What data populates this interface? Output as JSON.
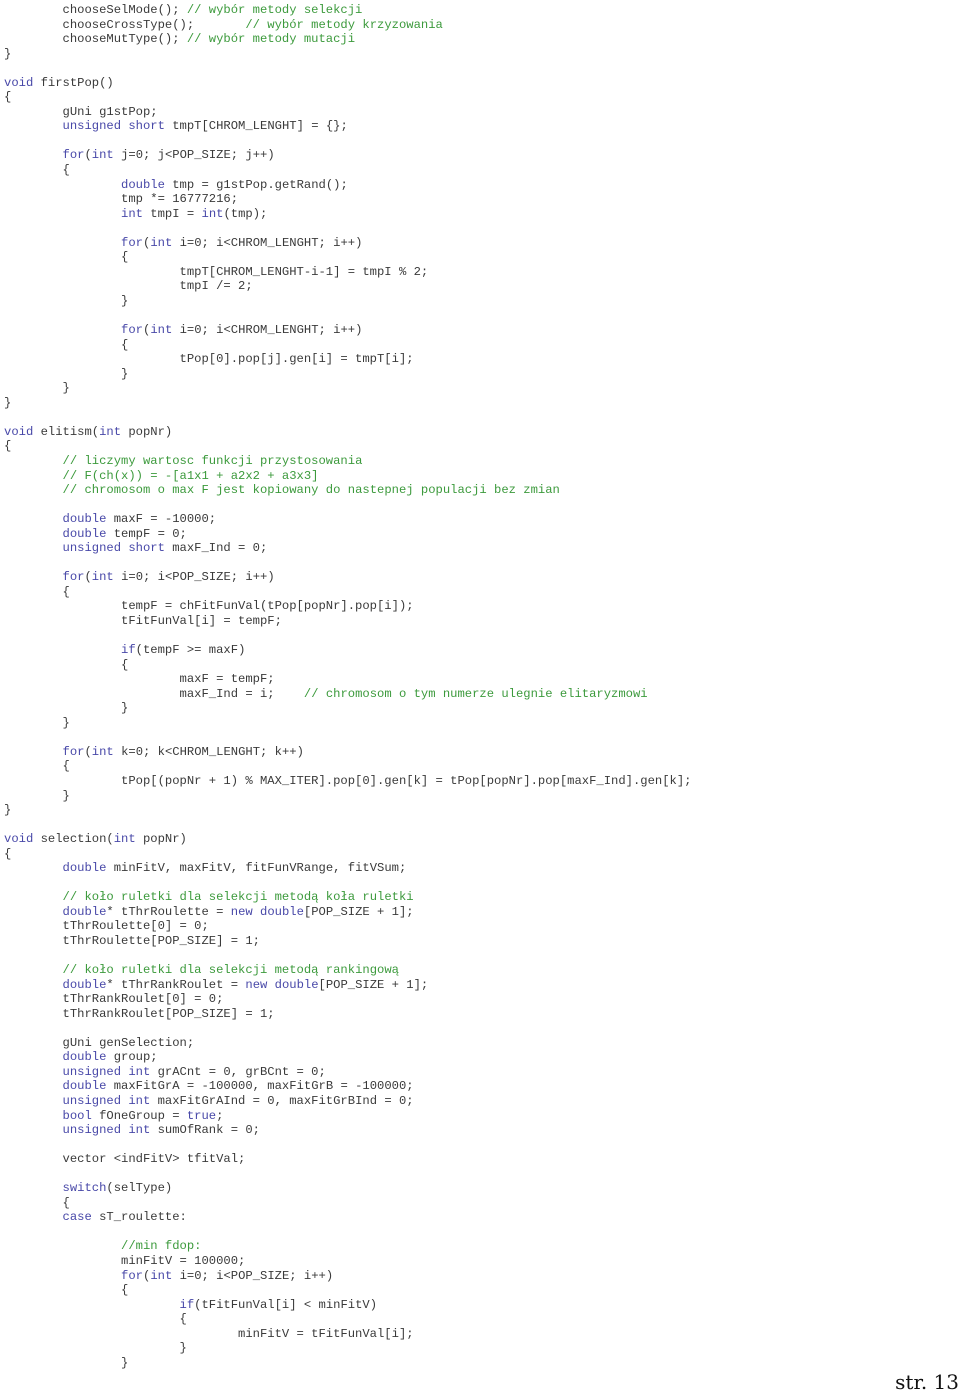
{
  "document": {
    "lines": [
      [
        {
          "t": "        chooseSelMode(); "
        },
        {
          "t": "// wybór metody selekcji",
          "c": "cm"
        }
      ],
      [
        {
          "t": "        chooseCrossType();       "
        },
        {
          "t": "// wybór metody krzyzowania",
          "c": "cm"
        }
      ],
      [
        {
          "t": "        chooseMutType(); "
        },
        {
          "t": "// wybór metody mutacji",
          "c": "cm"
        }
      ],
      [
        {
          "t": "}"
        }
      ],
      [
        {
          "t": ""
        }
      ],
      [
        {
          "t": "void",
          "c": "kw"
        },
        {
          "t": " firstPop()"
        }
      ],
      [
        {
          "t": "{"
        }
      ],
      [
        {
          "t": "        gUni g1stPop;"
        }
      ],
      [
        {
          "t": "        "
        },
        {
          "t": "unsigned short",
          "c": "kw"
        },
        {
          "t": " tmpT[CHROM_LENGHT] = {};"
        }
      ],
      [
        {
          "t": ""
        }
      ],
      [
        {
          "t": "        "
        },
        {
          "t": "for",
          "c": "kw"
        },
        {
          "t": "("
        },
        {
          "t": "int",
          "c": "kw"
        },
        {
          "t": " j=0; j<POP_SIZE; j++)"
        }
      ],
      [
        {
          "t": "        {"
        }
      ],
      [
        {
          "t": "                "
        },
        {
          "t": "double",
          "c": "kw"
        },
        {
          "t": " tmp = g1stPop.getRand();"
        }
      ],
      [
        {
          "t": "                tmp *= 16777216;"
        }
      ],
      [
        {
          "t": "                "
        },
        {
          "t": "int",
          "c": "kw"
        },
        {
          "t": " tmpI = "
        },
        {
          "t": "int",
          "c": "kw"
        },
        {
          "t": "(tmp);"
        }
      ],
      [
        {
          "t": ""
        }
      ],
      [
        {
          "t": "                "
        },
        {
          "t": "for",
          "c": "kw"
        },
        {
          "t": "("
        },
        {
          "t": "int",
          "c": "kw"
        },
        {
          "t": " i=0; i<CHROM_LENGHT; i++)"
        }
      ],
      [
        {
          "t": "                {"
        }
      ],
      [
        {
          "t": "                        tmpT[CHROM_LENGHT-i-1] = tmpI % 2;"
        }
      ],
      [
        {
          "t": "                        tmpI /= 2;"
        }
      ],
      [
        {
          "t": "                }"
        }
      ],
      [
        {
          "t": ""
        }
      ],
      [
        {
          "t": "                "
        },
        {
          "t": "for",
          "c": "kw"
        },
        {
          "t": "("
        },
        {
          "t": "int",
          "c": "kw"
        },
        {
          "t": " i=0; i<CHROM_LENGHT; i++)"
        }
      ],
      [
        {
          "t": "                {"
        }
      ],
      [
        {
          "t": "                        tPop[0].pop[j].gen[i] = tmpT[i];"
        }
      ],
      [
        {
          "t": "                }"
        }
      ],
      [
        {
          "t": "        }"
        }
      ],
      [
        {
          "t": "}"
        }
      ],
      [
        {
          "t": ""
        }
      ],
      [
        {
          "t": "void",
          "c": "kw"
        },
        {
          "t": " elitism("
        },
        {
          "t": "int",
          "c": "kw"
        },
        {
          "t": " popNr)"
        }
      ],
      [
        {
          "t": "{"
        }
      ],
      [
        {
          "t": "        "
        },
        {
          "t": "// liczymy wartosc funkcji przystosowania",
          "c": "cm"
        }
      ],
      [
        {
          "t": "        "
        },
        {
          "t": "// F(ch(x)) = -[a1x1 + a2x2 + a3x3]",
          "c": "cm"
        }
      ],
      [
        {
          "t": "        "
        },
        {
          "t": "// chromosom o max F jest kopiowany do nastepnej populacji bez zmian",
          "c": "cm"
        }
      ],
      [
        {
          "t": ""
        }
      ],
      [
        {
          "t": "        "
        },
        {
          "t": "double",
          "c": "kw"
        },
        {
          "t": " maxF = -10000;"
        }
      ],
      [
        {
          "t": "        "
        },
        {
          "t": "double",
          "c": "kw"
        },
        {
          "t": " tempF = 0;"
        }
      ],
      [
        {
          "t": "        "
        },
        {
          "t": "unsigned short",
          "c": "kw"
        },
        {
          "t": " maxF_Ind = 0;"
        }
      ],
      [
        {
          "t": ""
        }
      ],
      [
        {
          "t": "        "
        },
        {
          "t": "for",
          "c": "kw"
        },
        {
          "t": "("
        },
        {
          "t": "int",
          "c": "kw"
        },
        {
          "t": " i=0; i<POP_SIZE; i++)"
        }
      ],
      [
        {
          "t": "        {"
        }
      ],
      [
        {
          "t": "                tempF = chFitFunVal(tPop[popNr].pop[i]);"
        }
      ],
      [
        {
          "t": "                tFitFunVal[i] = tempF;"
        }
      ],
      [
        {
          "t": ""
        }
      ],
      [
        {
          "t": "                "
        },
        {
          "t": "if",
          "c": "kw"
        },
        {
          "t": "(tempF >= maxF)"
        }
      ],
      [
        {
          "t": "                {"
        }
      ],
      [
        {
          "t": "                        maxF = tempF;"
        }
      ],
      [
        {
          "t": "                        maxF_Ind = i;    "
        },
        {
          "t": "// chromosom o tym numerze ulegnie elitaryzmowi",
          "c": "cm"
        }
      ],
      [
        {
          "t": "                }"
        }
      ],
      [
        {
          "t": "        }"
        }
      ],
      [
        {
          "t": ""
        }
      ],
      [
        {
          "t": "        "
        },
        {
          "t": "for",
          "c": "kw"
        },
        {
          "t": "("
        },
        {
          "t": "int",
          "c": "kw"
        },
        {
          "t": " k=0; k<CHROM_LENGHT; k++)"
        }
      ],
      [
        {
          "t": "        {"
        }
      ],
      [
        {
          "t": "                tPop[(popNr + 1) % MAX_ITER].pop[0].gen[k] = tPop[popNr].pop[maxF_Ind].gen[k];"
        }
      ],
      [
        {
          "t": "        }"
        }
      ],
      [
        {
          "t": "}"
        }
      ],
      [
        {
          "t": ""
        }
      ],
      [
        {
          "t": "void",
          "c": "kw"
        },
        {
          "t": " selection("
        },
        {
          "t": "int",
          "c": "kw"
        },
        {
          "t": " popNr)"
        }
      ],
      [
        {
          "t": "{"
        }
      ],
      [
        {
          "t": "        "
        },
        {
          "t": "double",
          "c": "kw"
        },
        {
          "t": " minFitV, maxFitV, fitFunVRange, fitVSum;"
        }
      ],
      [
        {
          "t": ""
        }
      ],
      [
        {
          "t": "        "
        },
        {
          "t": "// koło ruletki dla selekcji metodą koła ruletki",
          "c": "cm"
        }
      ],
      [
        {
          "t": "        "
        },
        {
          "t": "double",
          "c": "kw"
        },
        {
          "t": "* tThrRoulette = "
        },
        {
          "t": "new double",
          "c": "kw"
        },
        {
          "t": "[POP_SIZE + 1];"
        }
      ],
      [
        {
          "t": "        tThrRoulette[0] = 0;"
        }
      ],
      [
        {
          "t": "        tThrRoulette[POP_SIZE] = 1;"
        }
      ],
      [
        {
          "t": ""
        }
      ],
      [
        {
          "t": "        "
        },
        {
          "t": "// koło ruletki dla selekcji metodą rankingową",
          "c": "cm"
        }
      ],
      [
        {
          "t": "        "
        },
        {
          "t": "double",
          "c": "kw"
        },
        {
          "t": "* tThrRankRoulet = "
        },
        {
          "t": "new double",
          "c": "kw"
        },
        {
          "t": "[POP_SIZE + 1];"
        }
      ],
      [
        {
          "t": "        tThrRankRoulet[0] = 0;"
        }
      ],
      [
        {
          "t": "        tThrRankRoulet[POP_SIZE] = 1;"
        }
      ],
      [
        {
          "t": ""
        }
      ],
      [
        {
          "t": "        gUni genSelection;"
        }
      ],
      [
        {
          "t": "        "
        },
        {
          "t": "double",
          "c": "kw"
        },
        {
          "t": " group;"
        }
      ],
      [
        {
          "t": "        "
        },
        {
          "t": "unsigned int",
          "c": "kw"
        },
        {
          "t": " grACnt = 0, grBCnt = 0;"
        }
      ],
      [
        {
          "t": "        "
        },
        {
          "t": "double",
          "c": "kw"
        },
        {
          "t": " maxFitGrA = -100000, maxFitGrB = -100000;"
        }
      ],
      [
        {
          "t": "        "
        },
        {
          "t": "unsigned int",
          "c": "kw"
        },
        {
          "t": " maxFitGrAInd = 0, maxFitGrBInd = 0;"
        }
      ],
      [
        {
          "t": "        "
        },
        {
          "t": "bool",
          "c": "kw"
        },
        {
          "t": " fOneGroup = "
        },
        {
          "t": "true",
          "c": "kw"
        },
        {
          "t": ";"
        }
      ],
      [
        {
          "t": "        "
        },
        {
          "t": "unsigned int",
          "c": "kw"
        },
        {
          "t": " sumOfRank = 0;"
        }
      ],
      [
        {
          "t": ""
        }
      ],
      [
        {
          "t": "        vector <indFitV> tfitVal;"
        }
      ],
      [
        {
          "t": ""
        }
      ],
      [
        {
          "t": "        "
        },
        {
          "t": "switch",
          "c": "kw"
        },
        {
          "t": "(selType)"
        }
      ],
      [
        {
          "t": "        {"
        }
      ],
      [
        {
          "t": "        "
        },
        {
          "t": "case",
          "c": "kw"
        },
        {
          "t": " sT_roulette:"
        }
      ],
      [
        {
          "t": ""
        }
      ],
      [
        {
          "t": "                "
        },
        {
          "t": "//min fdop:",
          "c": "cm"
        }
      ],
      [
        {
          "t": "                minFitV = 100000;"
        }
      ],
      [
        {
          "t": "                "
        },
        {
          "t": "for",
          "c": "kw"
        },
        {
          "t": "("
        },
        {
          "t": "int",
          "c": "kw"
        },
        {
          "t": " i=0; i<POP_SIZE; i++)"
        }
      ],
      [
        {
          "t": "                {"
        }
      ],
      [
        {
          "t": "                        "
        },
        {
          "t": "if",
          "c": "kw"
        },
        {
          "t": "(tFitFunVal[i] < minFitV)"
        }
      ],
      [
        {
          "t": "                        {"
        }
      ],
      [
        {
          "t": "                                minFitV = tFitFunVal[i];"
        }
      ],
      [
        {
          "t": "                        }"
        }
      ],
      [
        {
          "t": "                }"
        }
      ]
    ],
    "page_label": "str. 13"
  },
  "colors": {
    "keyword": "#4848a8",
    "comment": "#3c9a3c",
    "text": "#3a3a3a"
  }
}
